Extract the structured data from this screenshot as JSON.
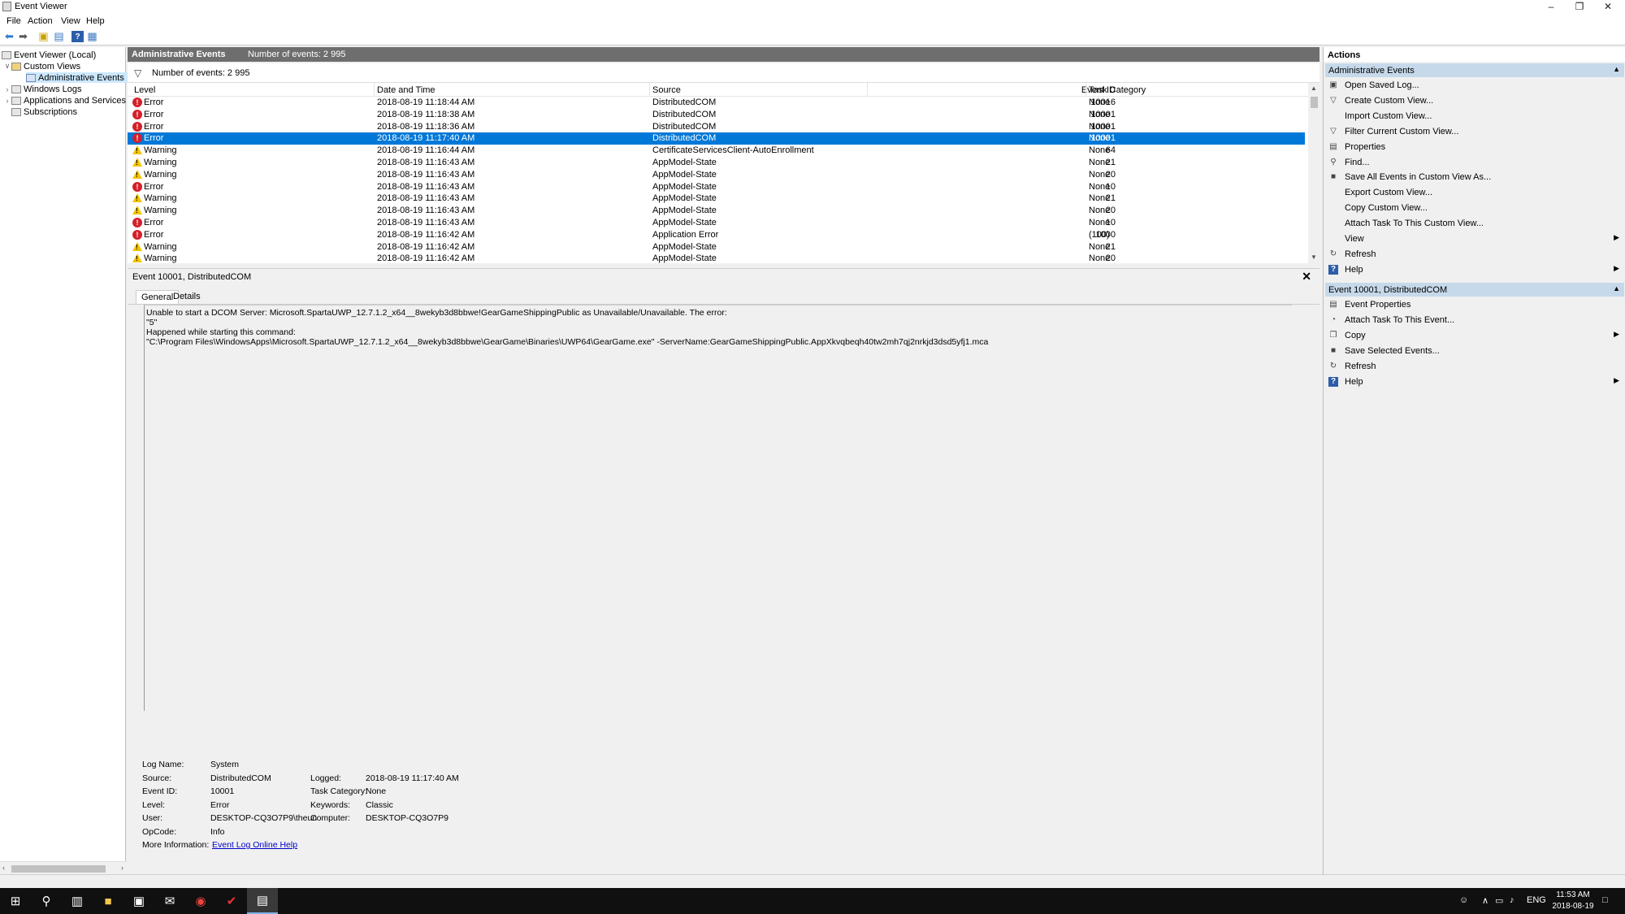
{
  "window": {
    "title": "Event Viewer",
    "minimize_icon": "minimize-icon",
    "restore_icon": "restore-icon",
    "close_icon": "close-icon"
  },
  "menu": [
    "File",
    "Action",
    "View",
    "Help"
  ],
  "toolbar": {
    "icons": [
      "back-arrow-icon",
      "forward-arrow-icon",
      "up-folder-icon",
      "show-hide-tree-icon",
      "help-icon",
      "show-hide-action-pane-icon"
    ]
  },
  "tree": {
    "root": "Event Viewer (Local)",
    "custom_views": "Custom Views",
    "administrative_events": "Administrative Events",
    "windows_logs": "Windows Logs",
    "apps_services": "Applications and Services Lo",
    "subscriptions": "Subscriptions"
  },
  "center": {
    "title": "Administrative Events",
    "count_label": "Number of events: 2 995",
    "filter_text": "Number of events: 2 995"
  },
  "grid": {
    "headers": [
      "Level",
      "Date and Time",
      "Source",
      "Event ID",
      "Task Category"
    ],
    "rows": [
      {
        "level": "Error",
        "date": "2018-08-19 11:18:44 AM",
        "source": "DistributedCOM",
        "id": "10016",
        "task": "None"
      },
      {
        "level": "Error",
        "date": "2018-08-19 11:18:38 AM",
        "source": "DistributedCOM",
        "id": "10001",
        "task": "None"
      },
      {
        "level": "Error",
        "date": "2018-08-19 11:18:36 AM",
        "source": "DistributedCOM",
        "id": "10001",
        "task": "None"
      },
      {
        "level": "Error",
        "date": "2018-08-19 11:17:40 AM",
        "source": "DistributedCOM",
        "id": "10001",
        "task": "None",
        "selected": true
      },
      {
        "level": "Warning",
        "date": "2018-08-19 11:16:44 AM",
        "source": "CertificateServicesClient-AutoEnrollment",
        "id": "64",
        "task": "None"
      },
      {
        "level": "Warning",
        "date": "2018-08-19 11:16:43 AM",
        "source": "AppModel-State",
        "id": "21",
        "task": "None"
      },
      {
        "level": "Warning",
        "date": "2018-08-19 11:16:43 AM",
        "source": "AppModel-State",
        "id": "20",
        "task": "None"
      },
      {
        "level": "Error",
        "date": "2018-08-19 11:16:43 AM",
        "source": "AppModel-State",
        "id": "10",
        "task": "None"
      },
      {
        "level": "Warning",
        "date": "2018-08-19 11:16:43 AM",
        "source": "AppModel-State",
        "id": "21",
        "task": "None"
      },
      {
        "level": "Warning",
        "date": "2018-08-19 11:16:43 AM",
        "source": "AppModel-State",
        "id": "20",
        "task": "None"
      },
      {
        "level": "Error",
        "date": "2018-08-19 11:16:43 AM",
        "source": "AppModel-State",
        "id": "10",
        "task": "None"
      },
      {
        "level": "Error",
        "date": "2018-08-19 11:16:42 AM",
        "source": "Application Error",
        "id": "1000",
        "task": "(100)"
      },
      {
        "level": "Warning",
        "date": "2018-08-19 11:16:42 AM",
        "source": "AppModel-State",
        "id": "21",
        "task": "None"
      },
      {
        "level": "Warning",
        "date": "2018-08-19 11:16:42 AM",
        "source": "AppModel-State",
        "id": "20",
        "task": "None"
      }
    ]
  },
  "detail": {
    "title": "Event 10001, DistributedCOM",
    "tabs": [
      "General",
      "Details"
    ],
    "message_lines": [
      "Unable to start a DCOM Server: Microsoft.SpartaUWP_12.7.1.2_x64__8wekyb3d8bbwe!GearGameShippingPublic as Unavailable/Unavailable. The error:",
      "\"5\"",
      "Happened while starting this command:",
      "\"C:\\Program Files\\WindowsApps\\Microsoft.SpartaUWP_12.7.1.2_x64__8wekyb3d8bbwe\\GearGame\\Binaries\\UWP64\\GearGame.exe\" -ServerName:GearGameShippingPublic.AppXkvqbeqh40tw2mh7qj2nrkjd3dsd5yfj1.mca"
    ],
    "props": {
      "log_name_label": "Log Name:",
      "log_name": "System",
      "source_label": "Source:",
      "source": "DistributedCOM",
      "logged_label": "Logged:",
      "logged": "2018-08-19 11:17:40 AM",
      "event_id_label": "Event ID:",
      "event_id": "10001",
      "task_label": "Task Category:",
      "task": "None",
      "level_label": "Level:",
      "level": "Error",
      "keywords_label": "Keywords:",
      "keywords": "Classic",
      "user_label": "User:",
      "user": "DESKTOP-CQ3O7P9\\theun",
      "computer_label": "Computer:",
      "computer": "DESKTOP-CQ3O7P9",
      "opcode_label": "OpCode:",
      "opcode": "Info",
      "more_label": "More Information:",
      "more_link": "Event Log Online Help"
    }
  },
  "actions": {
    "header": "Actions",
    "section1": "Administrative Events",
    "items1": [
      {
        "label": "Open Saved Log...",
        "icon": "open-log-icon"
      },
      {
        "label": "Create Custom View...",
        "icon": "filter-icon"
      },
      {
        "label": "Import Custom View...",
        "icon": ""
      },
      {
        "label": "Filter Current Custom View...",
        "icon": "filter-icon"
      },
      {
        "label": "Properties",
        "icon": "properties-icon"
      },
      {
        "label": "Find...",
        "icon": "find-icon"
      },
      {
        "label": "Save All Events in Custom View As...",
        "icon": "save-icon"
      },
      {
        "label": "Export Custom View...",
        "icon": ""
      },
      {
        "label": "Copy Custom View...",
        "icon": ""
      },
      {
        "label": "Attach Task To This Custom View...",
        "icon": ""
      },
      {
        "label": "View",
        "icon": "",
        "submenu": true
      },
      {
        "label": "Refresh",
        "icon": "refresh-icon"
      },
      {
        "label": "Help",
        "icon": "help-icon",
        "submenu": true
      }
    ],
    "section2": "Event 10001, DistributedCOM",
    "items2": [
      {
        "label": "Event Properties",
        "icon": "properties-icon"
      },
      {
        "label": "Attach Task To This Event...",
        "icon": "task-icon"
      },
      {
        "label": "Copy",
        "icon": "copy-icon",
        "submenu": true
      },
      {
        "label": "Save Selected Events...",
        "icon": "save-icon"
      },
      {
        "label": "Refresh",
        "icon": "refresh-icon"
      },
      {
        "label": "Help",
        "icon": "help-icon",
        "submenu": true
      }
    ]
  },
  "taskbar": {
    "apps": [
      "start-icon",
      "search-icon",
      "task-view-icon",
      "file-explorer-icon",
      "store-icon",
      "mail-icon",
      "chrome-icon",
      "app-icon",
      "event-viewer-icon"
    ],
    "language": "ENG",
    "time": "11:53 AM",
    "date": "2018-08-19"
  },
  "colors": {
    "selection": "#0078d7",
    "section_header": "#c6d9ea",
    "center_header": "#6e6e6e",
    "error": "#d4202a",
    "warning": "#f5c400",
    "taskbar": "#101010"
  }
}
